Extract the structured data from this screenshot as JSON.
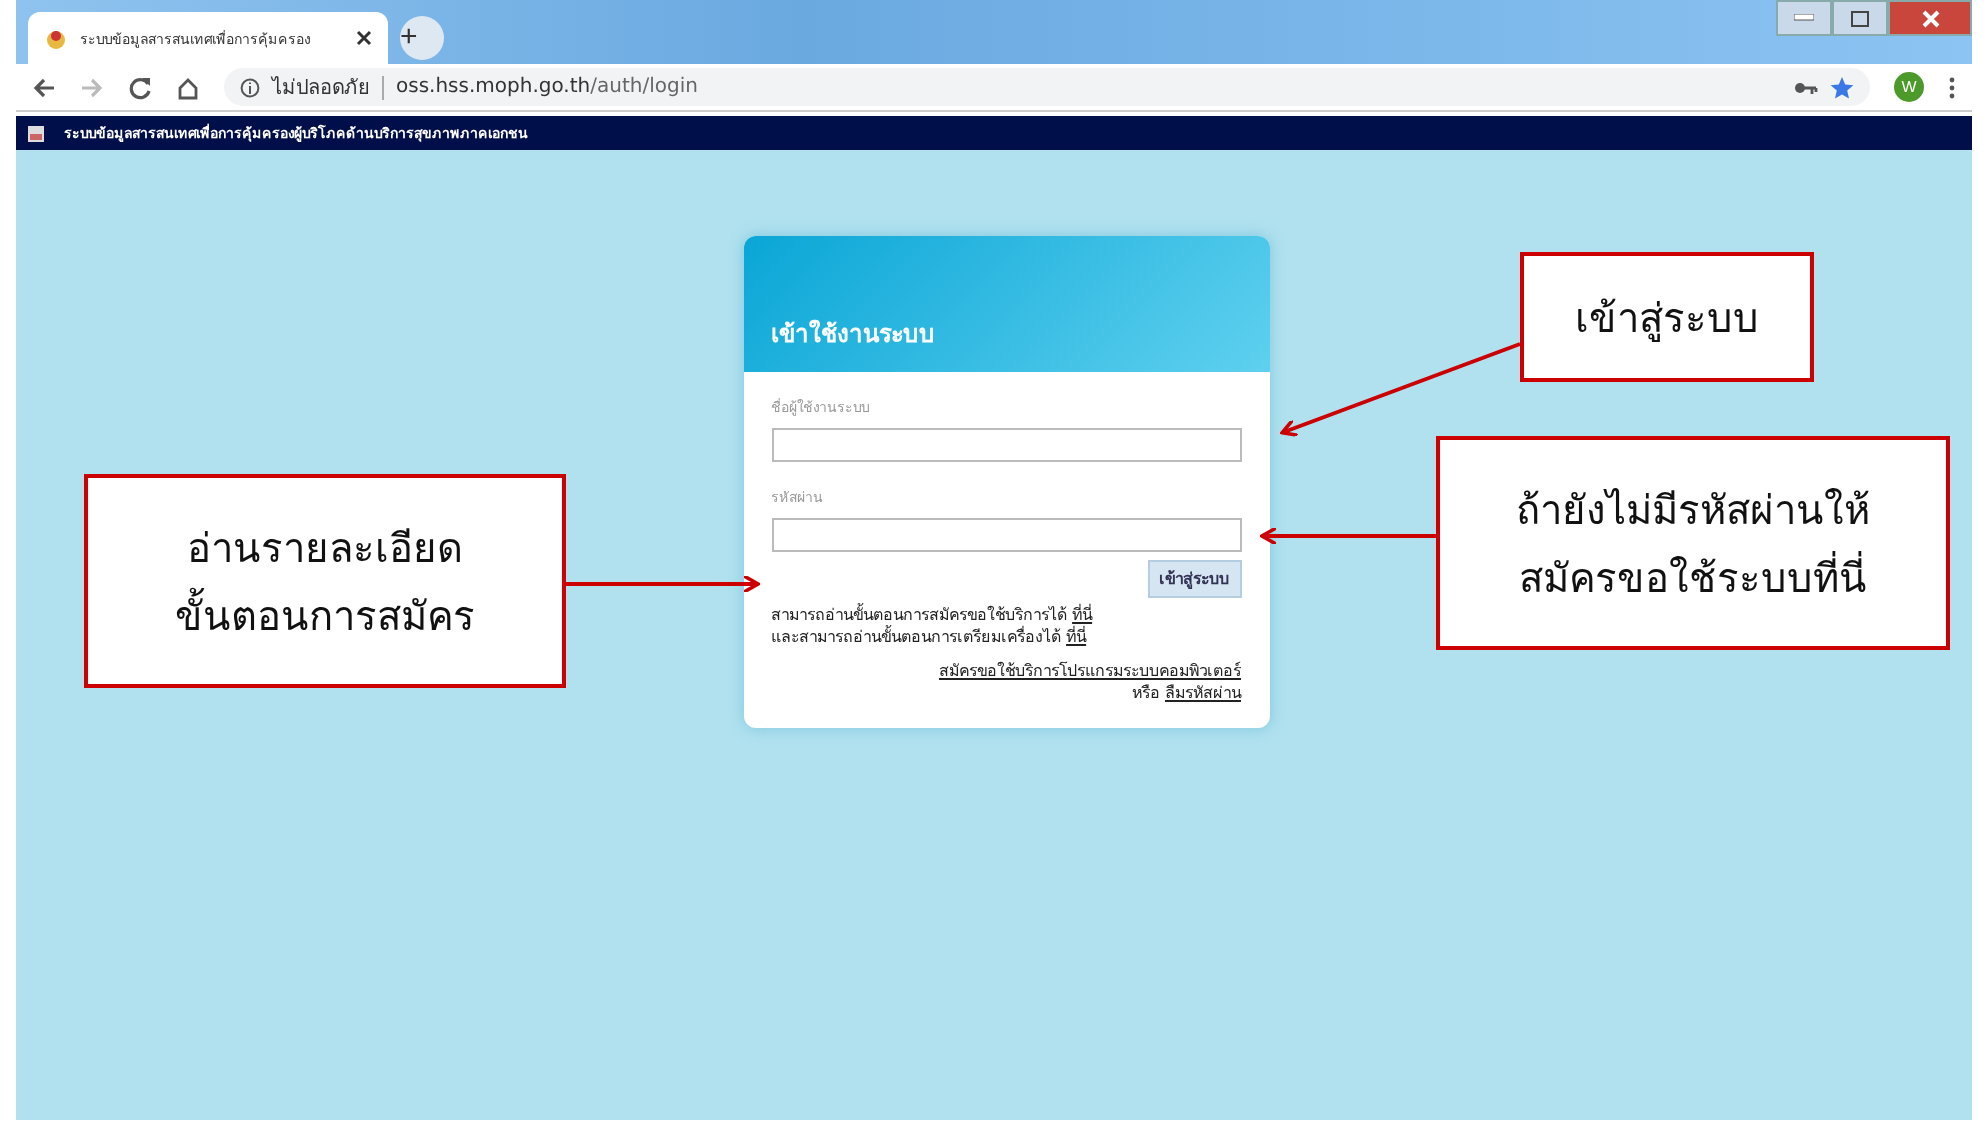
{
  "browser": {
    "tab_title": "ระบบข้อมูลสารสนเทศเพื่อการคุ้มครอง",
    "new_tab": "+",
    "security_label": "ไม่ปลอดภัย",
    "url_host": "oss.hss.moph.go.th",
    "url_path": "/auth/login",
    "profile_initial": "W"
  },
  "site_header": {
    "title": "ระบบข้อมูลสารสนเทศเพื่อการคุ้มครองผู้บริโภคด้านบริการสุขภาพภาคเอกชน"
  },
  "login": {
    "title": "เข้าใช้งานระบบ",
    "fields": [
      {
        "label": "ชื่อผู้ใช้งานระบบ"
      },
      {
        "label": "รหัสผ่าน"
      }
    ],
    "submit": "เข้าสู่ระบบ",
    "help_lines": [
      {
        "text": "สามารถอ่านขั้นตอนการสมัครขอใช้บริการได้",
        "link": "ที่นี่"
      },
      {
        "text": "และสามารถอ่านขั้นตอนการเตรียมเครื่องได้",
        "link": "ที่นี่"
      }
    ],
    "register_link": "สมัครขอใช้บริการโปรแกรมระบบคอมพิวเตอร์",
    "or_text": "หรือ",
    "forgot_link": "ลืมรหัสผ่าน"
  },
  "callouts": [
    {
      "kind": "right-top",
      "lines": [
        "เข้าสู่ระบบ"
      ]
    },
    {
      "kind": "right-bottom",
      "lines": [
        "ถ้ายังไม่มีรหัสผ่านให้",
        "สมัครขอใช้ระบบที่นี่"
      ]
    },
    {
      "kind": "left",
      "lines": [
        "อ่านรายละเอียด",
        "ขั้นตอนการสมัคร"
      ]
    }
  ]
}
